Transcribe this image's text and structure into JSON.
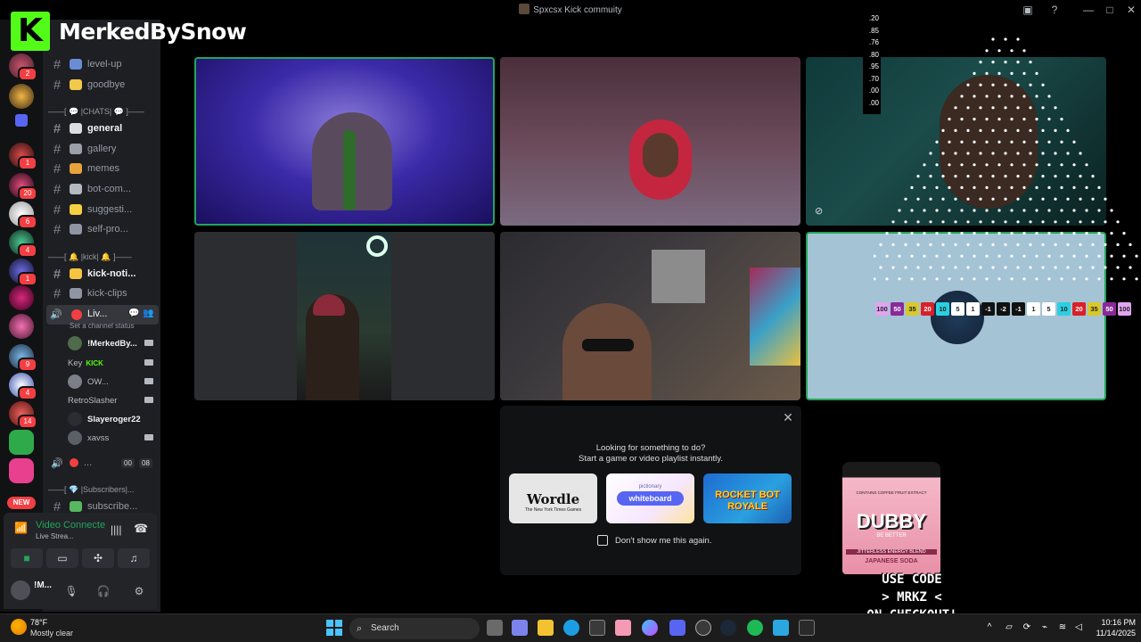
{
  "window": {
    "title": "Spxcsx Kick commuity"
  },
  "overlay": {
    "brand_logo": "K",
    "brand_name": "MerkedBySnow",
    "ticker": [
      ".20",
      ".85",
      ".76",
      ".80",
      ".95",
      ".70",
      ".00",
      ".00"
    ],
    "chips": [
      "100",
      "50",
      "35",
      "20",
      "10",
      "5",
      "1",
      "-1",
      "-2",
      "-1",
      "1",
      "5",
      "10",
      "20",
      "35",
      "50",
      "100"
    ],
    "promo": {
      "line1": "USE CODE",
      "line2": "> MRKZ <",
      "line3": "ON CHECKOUT!"
    },
    "product": {
      "top": "CONTAINS COFFEE FRUIT EXTRACT",
      "name": "DUBBY",
      "tag": "BE BETTER",
      "sub": "JITTERLESS ENERGY BLEND",
      "flavor": "JAPANESE SODA"
    }
  },
  "rail": {
    "badges": [
      "2",
      "1",
      "20",
      "6",
      "4",
      "1",
      "9",
      "4",
      "14"
    ],
    "new_label": "NEW"
  },
  "channels": {
    "top": [
      {
        "name": "level-up"
      },
      {
        "name": "goodbye"
      }
    ],
    "cat_chats": "——[ 💬 |CHATS| 💬 ]——",
    "chats": [
      {
        "name": "general",
        "bold": true
      },
      {
        "name": "gallery"
      },
      {
        "name": "memes"
      },
      {
        "name": "bot-com..."
      },
      {
        "name": "suggesti..."
      },
      {
        "name": "self-pro..."
      }
    ],
    "cat_kick": "——[ 🔔 |kick| 🔔 ]——",
    "kick": [
      {
        "name": "kick-noti...",
        "bold": true
      },
      {
        "name": "kick-clips"
      }
    ],
    "voice_active": "Liv...",
    "set_status": "Set a channel status",
    "voice_users": [
      "!MerkedBy...",
      "Key",
      "OW...",
      "RetroSlasher",
      "Slayeroger22",
      "xavss"
    ],
    "key_tag": "KICK",
    "voice2": {
      "name": "...",
      "count1": "00",
      "count2": "08"
    },
    "cat_subs": "——[ 💎 |Subscribers|...",
    "subs": [
      {
        "name": "subscribe..."
      }
    ]
  },
  "voice_panel": {
    "title": "Video Connecte",
    "subtitle": "Live Strea..."
  },
  "user": {
    "name": "!M..."
  },
  "activity": {
    "line1": "Looking for something to do?",
    "line2": "Start a game or video playlist instantly.",
    "cards": [
      {
        "title": "Wordle",
        "subtitle": "The New York Times Games"
      },
      {
        "title": "whiteboard",
        "subtitle": "pictionary"
      },
      {
        "title": "ROCKET BOT",
        "subtitle": "ROYALE"
      }
    ],
    "checkbox_label": "Don't show me this again."
  },
  "taskbar": {
    "weather_temp": "78°F",
    "weather_desc": "Mostly clear",
    "search_label": "Search",
    "time": "10:16 PM",
    "date": "11/14/2025"
  }
}
